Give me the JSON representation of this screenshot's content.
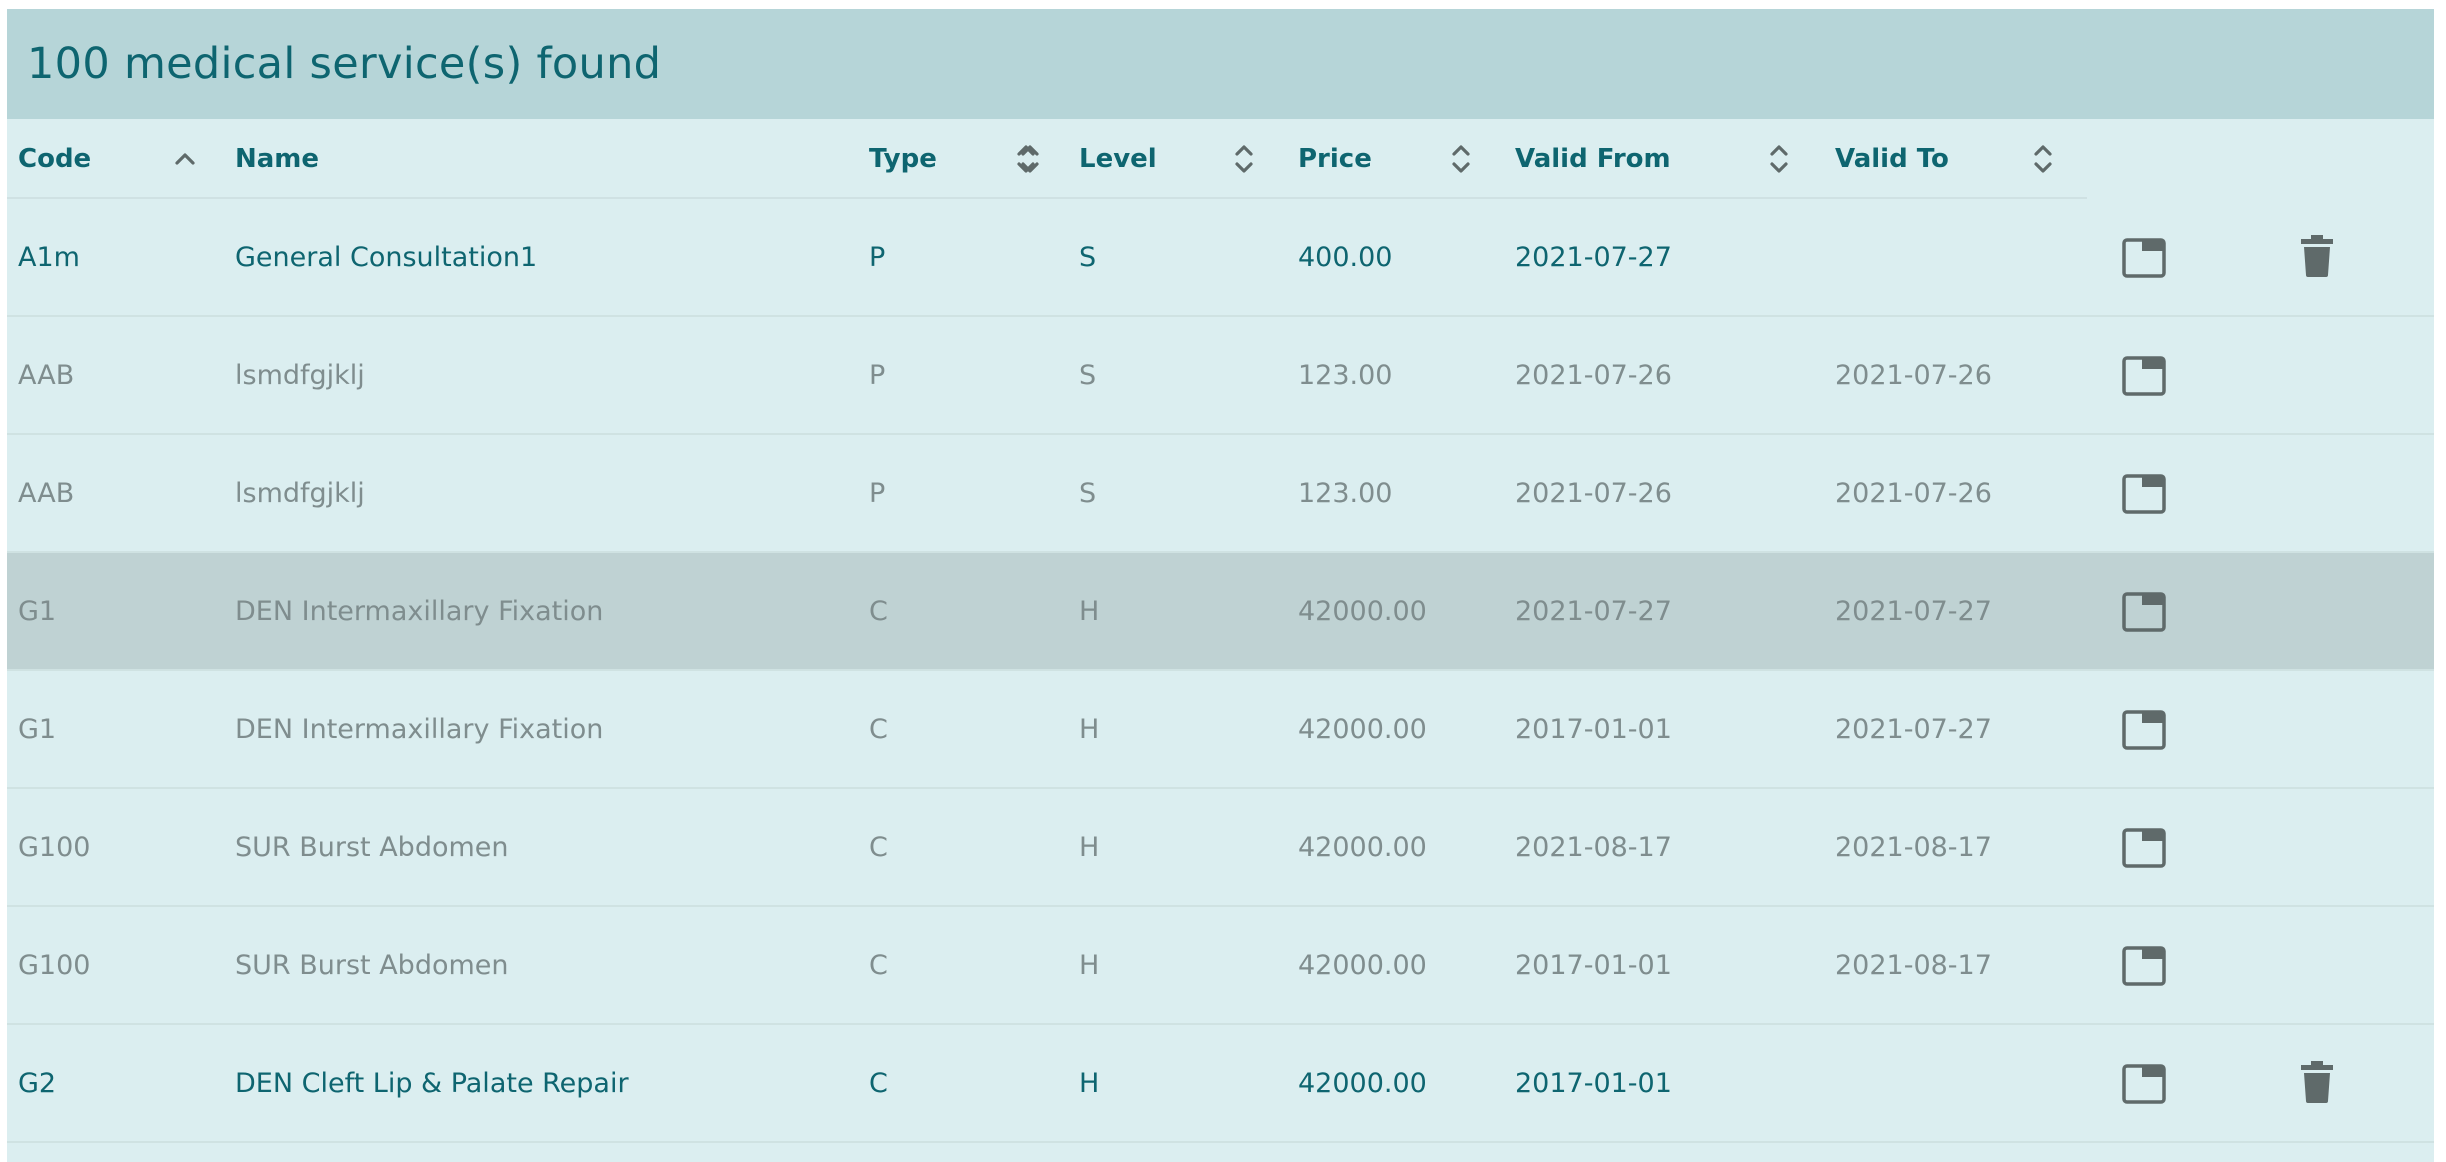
{
  "header": {
    "title": "100 medical service(s) found"
  },
  "table": {
    "columns": [
      {
        "label": "Code",
        "sort": "asc"
      },
      {
        "label": "Name",
        "sort": "none"
      },
      {
        "label": "Type",
        "sort": "none"
      },
      {
        "label": "Level",
        "sort": "none"
      },
      {
        "label": "Price",
        "sort": "none"
      },
      {
        "label": "Valid From",
        "sort": "none"
      },
      {
        "label": "Valid To",
        "sort": "none"
      }
    ],
    "rows": [
      {
        "code": "A1m",
        "name": "General Consultation1",
        "type": "P",
        "level": "S",
        "price": "400.00",
        "valid_from": "2021-07-27",
        "valid_to": "",
        "status": "active",
        "deletable": true
      },
      {
        "code": "AAB",
        "name": "lsmdfgjklj",
        "type": "P",
        "level": "S",
        "price": "123.00",
        "valid_from": "2021-07-26",
        "valid_to": "2021-07-26",
        "status": "inactive",
        "deletable": false
      },
      {
        "code": "AAB",
        "name": "lsmdfgjklj",
        "type": "P",
        "level": "S",
        "price": "123.00",
        "valid_from": "2021-07-26",
        "valid_to": "2021-07-26",
        "status": "inactive",
        "deletable": false
      },
      {
        "code": "G1",
        "name": "DEN Intermaxillary Fixation",
        "type": "C",
        "level": "H",
        "price": "42000.00",
        "valid_from": "2021-07-27",
        "valid_to": "2021-07-27",
        "status": "inactive",
        "deletable": false,
        "selected": true
      },
      {
        "code": "G1",
        "name": "DEN Intermaxillary Fixation",
        "type": "C",
        "level": "H",
        "price": "42000.00",
        "valid_from": "2017-01-01",
        "valid_to": "2021-07-27",
        "status": "inactive",
        "deletable": false
      },
      {
        "code": "G100",
        "name": "SUR Burst Abdomen",
        "type": "C",
        "level": "H",
        "price": "42000.00",
        "valid_from": "2021-08-17",
        "valid_to": "2021-08-17",
        "status": "inactive",
        "deletable": false
      },
      {
        "code": "G100",
        "name": "SUR Burst Abdomen",
        "type": "C",
        "level": "H",
        "price": "42000.00",
        "valid_from": "2017-01-01",
        "valid_to": "2021-08-17",
        "status": "inactive",
        "deletable": false
      },
      {
        "code": "G2",
        "name": "DEN Cleft Lip & Palate Repair",
        "type": "C",
        "level": "H",
        "price": "42000.00",
        "valid_from": "2017-01-01",
        "valid_to": "",
        "status": "active",
        "deletable": true
      }
    ]
  },
  "icons": {
    "sort": "sort-updown-icon",
    "sort_asc": "chevron-up-icon",
    "open": "open-in-new-tab-icon",
    "delete": "trash-icon"
  },
  "colors": {
    "header_bg": "#b6d5d8",
    "panel_bg": "#dbeef0",
    "selected_row_bg": "#bfd2d3",
    "active_text": "#0e6570",
    "inactive_text": "#7f8d8e",
    "icon": "#5f6a6a"
  }
}
